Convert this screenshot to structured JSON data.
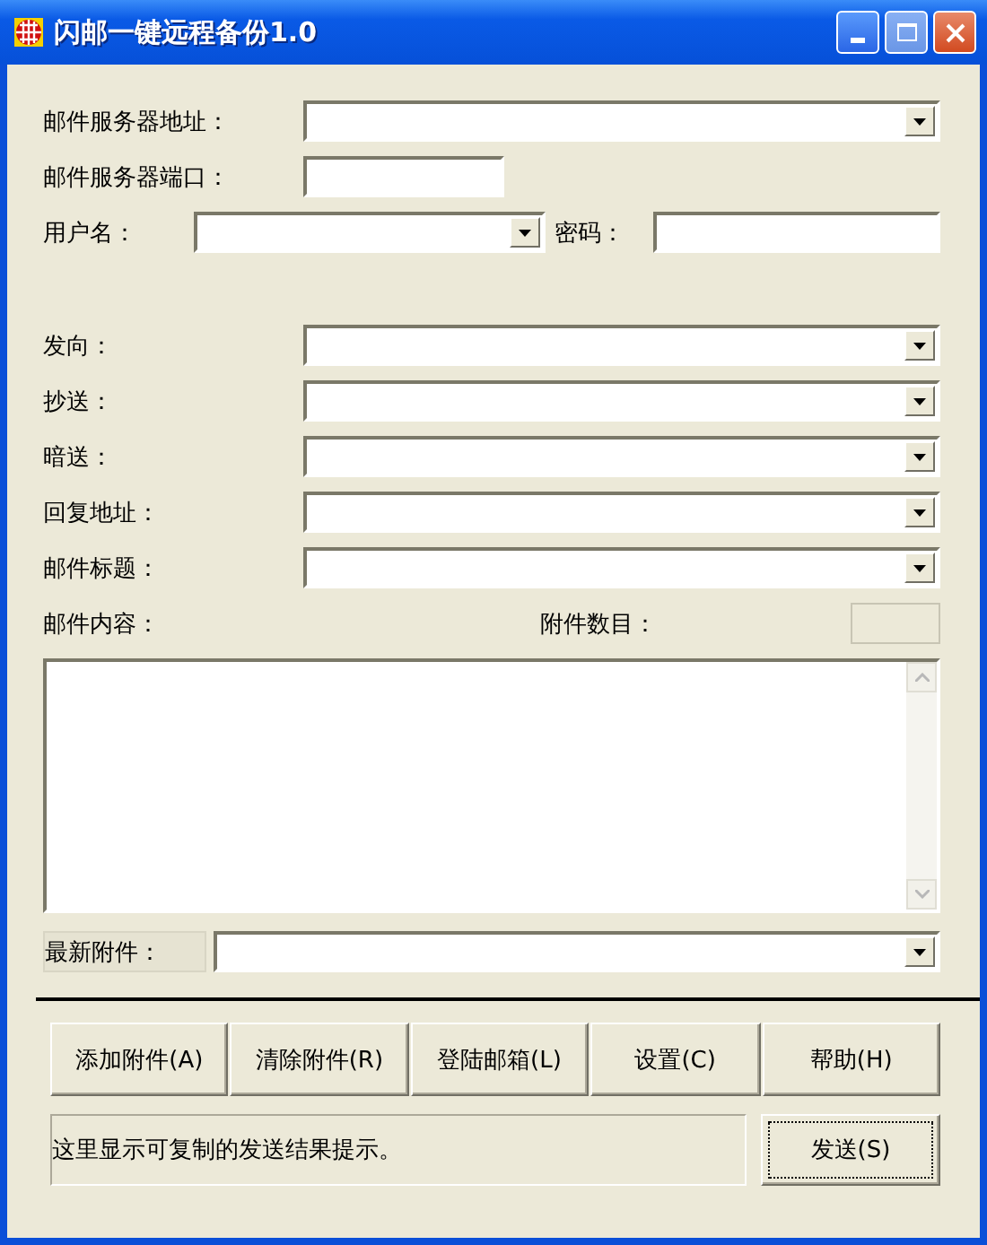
{
  "window": {
    "title": "闪邮一键远程备份1.0"
  },
  "server_fields": [
    {
      "label": "邮件服务器地址：",
      "kind": "combo"
    },
    {
      "label": "邮件服务器端口：",
      "kind": "short"
    }
  ],
  "account": {
    "username_label": "用户名：",
    "password_label": "密码："
  },
  "recipient_fields": [
    {
      "label": "发向：",
      "kind": "combo"
    },
    {
      "label": "抄送：",
      "kind": "combo"
    },
    {
      "label": "暗送：",
      "kind": "combo"
    },
    {
      "label": "回复地址：",
      "kind": "combo"
    },
    {
      "label": "邮件标题：",
      "kind": "combo"
    }
  ],
  "body": {
    "label": "邮件内容：",
    "attachment_count_label": "附件数目："
  },
  "latest_attachment": {
    "label": "最新附件："
  },
  "buttons": [
    "添加附件(A)",
    "清除附件(R)",
    "登陆邮箱(L)",
    "设置(C)",
    "帮助(H)"
  ],
  "status": {
    "text": "这里显示可复制的发送结果提示。"
  },
  "send_button": {
    "label": "发送(S)",
    "focused": true
  }
}
